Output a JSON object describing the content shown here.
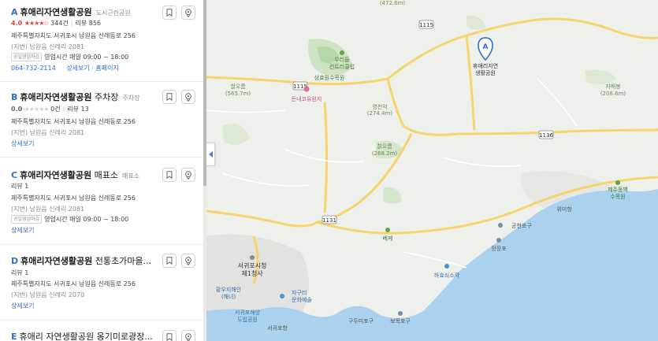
{
  "results": [
    {
      "letter": "A",
      "name": "휴애리자연생활공원",
      "suffix": "",
      "category": "도시근린공원",
      "score": "4.0",
      "stars": "★★★★☆",
      "reviews_count": "344건",
      "reviews": "리뷰 856",
      "address": "제주특별자치도 서귀포시 남원읍 신례동로 256",
      "address_jibun_tag": "(지번)",
      "address_jibun": "남원읍 신례리 2081",
      "hours_tag": "공일영업마감",
      "hours": "영업시간 매일 09:00 ~ 18:00",
      "phone": "064-732-2114",
      "links": "상세보기 · 홈페이지"
    },
    {
      "letter": "B",
      "name": "휴애리자연생활공원",
      "suffix": "주차장",
      "category": "주차장",
      "score": "0.0",
      "stars": "★★★★★",
      "reviews_count": "0건",
      "reviews": "리뷰 13",
      "address": "제주특별자치도 서귀포시 남원읍 신례동로 256",
      "address_jibun_tag": "(지번)",
      "address_jibun": "남원읍 신례리 2081",
      "detail": "상세보기"
    },
    {
      "letter": "C",
      "name": "휴애리자연생활공원",
      "suffix": "매표소",
      "category": "매표소",
      "reviews": "리뷰 1",
      "address": "제주특별자치도 서귀포시 남원읍 신례동로 256",
      "address_jibun_tag": "(지번)",
      "address_jibun": "남원읍 신례리 2081",
      "hours_tag": "공일영업마감",
      "hours": "영업시간 매일 09:00 ~ 18:00",
      "detail": "상세보기"
    },
    {
      "letter": "D",
      "name": "휴애리자연생활공원",
      "suffix": "전통초가마을...",
      "category": "",
      "reviews": "리뷰 1",
      "address": "제주특별자치도 서귀포시 남원읍 신례동로 256",
      "address_jibun_tag": "(지번)",
      "address_jibun": "남원읍 신례리 2070",
      "detail": "상세보기"
    },
    {
      "letter": "E",
      "name": "휴애리 자연생활공원 옹기미로광장...",
      "suffix": "",
      "category": ""
    }
  ],
  "map": {
    "pin_label": "휴애리자연\n생활공원",
    "pin_label_1": "휴애리자연",
    "pin_label_2": "생활공원",
    "pin_letter": "A",
    "labels": {
      "top": "(472.6m)",
      "road_1115a": "1115",
      "road_1115b": "1115",
      "road_1136": "1136",
      "road_1131": "1131",
      "club_1": "우리들",
      "club_2": "컨트리클럽",
      "arboretum": "상효원수목원",
      "donne": "돈내코유원지",
      "mt1_1": "쌀오름",
      "mt1_2": "(565.7m)",
      "mt2_1": "영천악",
      "mt2_2": "(274.4m)",
      "mt3_1": "칡오름",
      "mt3_2": "(268.2m)",
      "mt4_1": "자배봉",
      "mt4_2": "(208.6m)",
      "park_1": "제주동백",
      "park_2": "수목원",
      "wimi": "위미항",
      "gongcheon": "공천포구",
      "mangjang": "망장포",
      "bekje": "베케",
      "hahyo": "하효쇠소깍",
      "city_1": "서귀포시청",
      "city_2": "제1청사",
      "hwang_1": "황우지해안",
      "hwang_2": "(해녀)",
      "seogwi_1": "서귀포해양",
      "seogwi_2": "도립공원",
      "seogwi_port": "서귀포항",
      "jagu_1": "자구리",
      "jagu_2": "문화예술",
      "bomok": "보목포구",
      "guduri": "구두미포구"
    }
  }
}
